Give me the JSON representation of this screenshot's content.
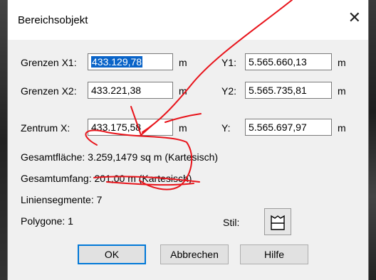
{
  "dialog": {
    "title": "Bereichsobjekt",
    "close_glyph": "✕"
  },
  "bounds": {
    "x1_label": "Grenzen X1:",
    "x1_value": "433.129,78",
    "x1_unit": "m",
    "y1_label": "Y1:",
    "y1_value": "5.565.660,13",
    "y1_unit": "m",
    "x2_label": "Grenzen X2:",
    "x2_value": "433.221,38",
    "x2_unit": "m",
    "y2_label": "Y2:",
    "y2_value": "5.565.735,81",
    "y2_unit": "m"
  },
  "center": {
    "x_label": "Zentrum X:",
    "x_value": "433.175,58",
    "x_unit": "m",
    "y_label": "Y:",
    "y_value": "5.565.697,97",
    "y_unit": "m"
  },
  "info": {
    "area_label": "Gesamtfläche:",
    "area_value": "3.259,1479 sq m (Kartesisch)",
    "perimeter_label": "Gesamtumfang:",
    "perimeter_value": "201,00 m (Kartesisch)",
    "segments_label": "Liniensegmente:",
    "segments_value": "7",
    "polygons_label": "Polygone:",
    "polygons_value": "1"
  },
  "style": {
    "label": "Stil:",
    "icon": "region-style-icon"
  },
  "buttons": {
    "ok": "OK",
    "cancel": "Abbrechen",
    "help": "Hilfe"
  },
  "colors": {
    "annotation": "#e8141b",
    "selection": "#0a64c8",
    "default_button_border": "#0078d7"
  }
}
